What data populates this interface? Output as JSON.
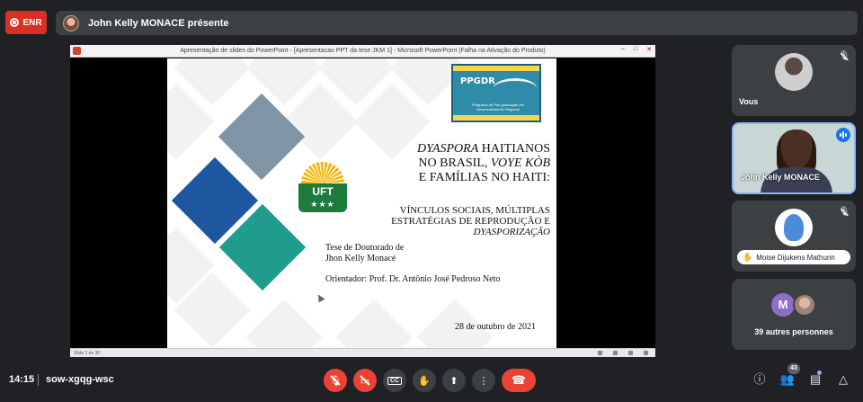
{
  "recording": {
    "label": "ENR"
  },
  "presenter": {
    "text": "John Kelly MONACE présente"
  },
  "share": {
    "window_title": "Apresentação de slides do PowerPoint - [Apresentacao PPT da tese JKM 1] - Microsoft PowerPoint (Falha na Ativação do Produto)",
    "status_text": "Slide 1 de 30",
    "slide": {
      "logo_ppgdr": "PPGDR",
      "logo_ppgdr_sub": "Programa de Pós-graduação em Desenvolvimento Regional",
      "logo_uft": "UFT",
      "logo_uft_stars": "★★★",
      "title_line1_a": "DYASPORA",
      "title_line1_b": " HAITIANOS",
      "title_line2_a": "NO BRASIL, ",
      "title_line2_b": "VOYE KÒB",
      "title_line3": "E FAMÍLIAS NO HAITI:",
      "subtitle_line1": "VÍNCULOS SOCIAIS, MÚLTIPLAS",
      "subtitle_line2": "ESTRATÉGIAS DE REPRODUÇÃO E",
      "subtitle_line3": "DYASPORIZAÇÃO",
      "thesis_line1": "Tese de Doutorado de",
      "thesis_line2": "Jhon Kelly Monacé",
      "advisor": "Orientador: Prof. Dr. Antônio José Pedroso Neto",
      "date": "28 de outubro de 2021"
    }
  },
  "participants": {
    "you": {
      "name": "Vous"
    },
    "john": {
      "name": "John Kelly MONACE"
    },
    "moise": {
      "name": "Moise Dijukens Mathurin"
    },
    "others": {
      "initial": "M",
      "text": "39 autres personnes"
    }
  },
  "bottom": {
    "time": "14:15",
    "meeting_code": "sow-xgqg-wsc",
    "cc_label": "CC",
    "people_count": "43"
  },
  "colors": {
    "accent_red": "#ea4335",
    "speaking_blue": "#1a73e8",
    "slide_blue": "#1e57a0",
    "slide_gray": "#7f95a5",
    "slide_teal": "#1f9c8c"
  }
}
